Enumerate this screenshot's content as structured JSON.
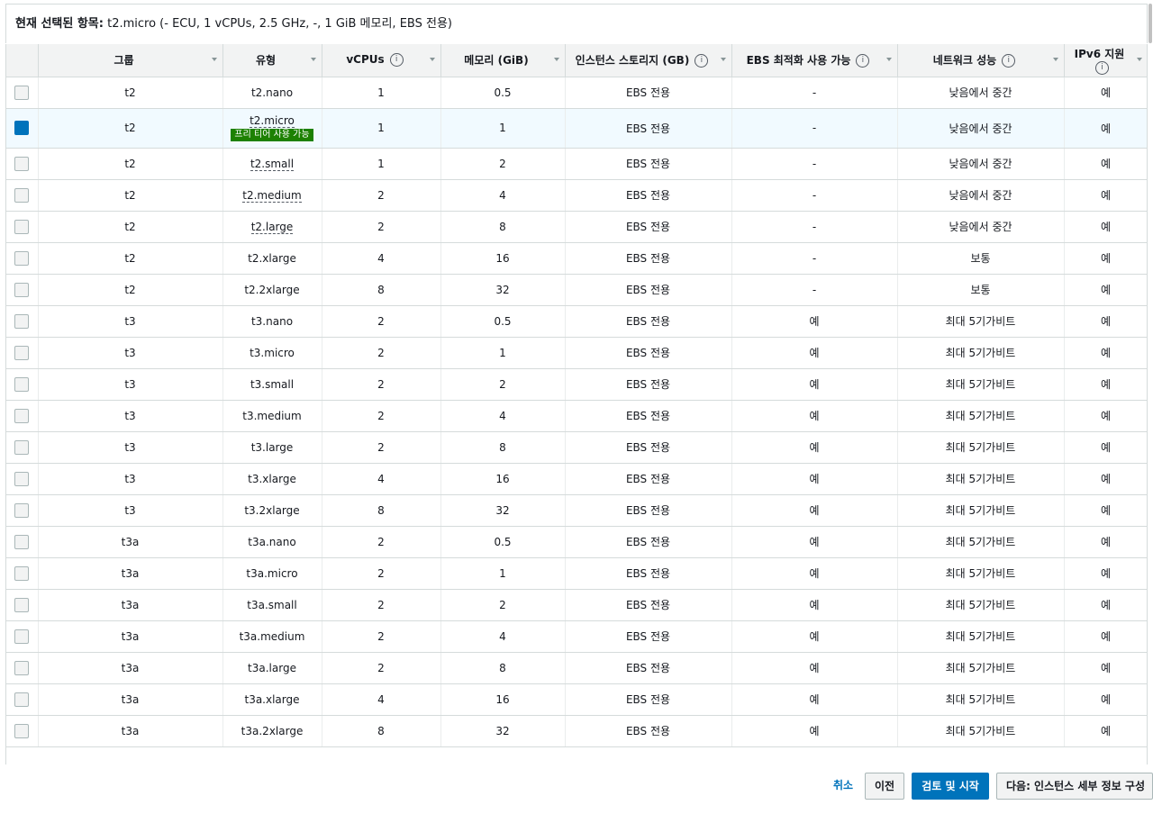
{
  "selection": {
    "label": "현재 선택된 항목:",
    "value": " t2.micro (- ECU, 1 vCPUs, 2.5 GHz, -, 1 GiB 메모리, EBS 전용)"
  },
  "table": {
    "columns": [
      {
        "label": "그룹",
        "info": false
      },
      {
        "label": "유형",
        "info": false
      },
      {
        "label": "vCPUs",
        "info": true
      },
      {
        "label": "메모리 (GiB)",
        "info": false
      },
      {
        "label": "인스턴스 스토리지 (GB)",
        "info": true
      },
      {
        "label": "EBS 최적화 사용 가능",
        "info": true
      },
      {
        "label": "네트워크 성능",
        "info": true
      },
      {
        "label": "IPv6 지원",
        "info": true
      }
    ],
    "info_glyph": "i",
    "free_tier_badge": "프리 티어 사용 가능",
    "rows": [
      {
        "group": "t2",
        "type": "t2.nano",
        "vcpu": "1",
        "memory": "0.5",
        "storage": "EBS 전용",
        "ebs": "-",
        "network": "낮음에서 중간",
        "ipv6": "예",
        "selected": false,
        "free": false,
        "dotted": false
      },
      {
        "group": "t2",
        "type": "t2.micro",
        "vcpu": "1",
        "memory": "1",
        "storage": "EBS 전용",
        "ebs": "-",
        "network": "낮음에서 중간",
        "ipv6": "예",
        "selected": true,
        "free": true,
        "dotted": true
      },
      {
        "group": "t2",
        "type": "t2.small",
        "vcpu": "1",
        "memory": "2",
        "storage": "EBS 전용",
        "ebs": "-",
        "network": "낮음에서 중간",
        "ipv6": "예",
        "selected": false,
        "free": false,
        "dotted": true
      },
      {
        "group": "t2",
        "type": "t2.medium",
        "vcpu": "2",
        "memory": "4",
        "storage": "EBS 전용",
        "ebs": "-",
        "network": "낮음에서 중간",
        "ipv6": "예",
        "selected": false,
        "free": false,
        "dotted": true
      },
      {
        "group": "t2",
        "type": "t2.large",
        "vcpu": "2",
        "memory": "8",
        "storage": "EBS 전용",
        "ebs": "-",
        "network": "낮음에서 중간",
        "ipv6": "예",
        "selected": false,
        "free": false,
        "dotted": true
      },
      {
        "group": "t2",
        "type": "t2.xlarge",
        "vcpu": "4",
        "memory": "16",
        "storage": "EBS 전용",
        "ebs": "-",
        "network": "보통",
        "ipv6": "예",
        "selected": false,
        "free": false,
        "dotted": false
      },
      {
        "group": "t2",
        "type": "t2.2xlarge",
        "vcpu": "8",
        "memory": "32",
        "storage": "EBS 전용",
        "ebs": "-",
        "network": "보통",
        "ipv6": "예",
        "selected": false,
        "free": false,
        "dotted": false
      },
      {
        "group": "t3",
        "type": "t3.nano",
        "vcpu": "2",
        "memory": "0.5",
        "storage": "EBS 전용",
        "ebs": "예",
        "network": "최대 5기가비트",
        "ipv6": "예",
        "selected": false,
        "free": false,
        "dotted": false
      },
      {
        "group": "t3",
        "type": "t3.micro",
        "vcpu": "2",
        "memory": "1",
        "storage": "EBS 전용",
        "ebs": "예",
        "network": "최대 5기가비트",
        "ipv6": "예",
        "selected": false,
        "free": false,
        "dotted": false
      },
      {
        "group": "t3",
        "type": "t3.small",
        "vcpu": "2",
        "memory": "2",
        "storage": "EBS 전용",
        "ebs": "예",
        "network": "최대 5기가비트",
        "ipv6": "예",
        "selected": false,
        "free": false,
        "dotted": false
      },
      {
        "group": "t3",
        "type": "t3.medium",
        "vcpu": "2",
        "memory": "4",
        "storage": "EBS 전용",
        "ebs": "예",
        "network": "최대 5기가비트",
        "ipv6": "예",
        "selected": false,
        "free": false,
        "dotted": false
      },
      {
        "group": "t3",
        "type": "t3.large",
        "vcpu": "2",
        "memory": "8",
        "storage": "EBS 전용",
        "ebs": "예",
        "network": "최대 5기가비트",
        "ipv6": "예",
        "selected": false,
        "free": false,
        "dotted": false
      },
      {
        "group": "t3",
        "type": "t3.xlarge",
        "vcpu": "4",
        "memory": "16",
        "storage": "EBS 전용",
        "ebs": "예",
        "network": "최대 5기가비트",
        "ipv6": "예",
        "selected": false,
        "free": false,
        "dotted": false
      },
      {
        "group": "t3",
        "type": "t3.2xlarge",
        "vcpu": "8",
        "memory": "32",
        "storage": "EBS 전용",
        "ebs": "예",
        "network": "최대 5기가비트",
        "ipv6": "예",
        "selected": false,
        "free": false,
        "dotted": false
      },
      {
        "group": "t3a",
        "type": "t3a.nano",
        "vcpu": "2",
        "memory": "0.5",
        "storage": "EBS 전용",
        "ebs": "예",
        "network": "최대 5기가비트",
        "ipv6": "예",
        "selected": false,
        "free": false,
        "dotted": false
      },
      {
        "group": "t3a",
        "type": "t3a.micro",
        "vcpu": "2",
        "memory": "1",
        "storage": "EBS 전용",
        "ebs": "예",
        "network": "최대 5기가비트",
        "ipv6": "예",
        "selected": false,
        "free": false,
        "dotted": false
      },
      {
        "group": "t3a",
        "type": "t3a.small",
        "vcpu": "2",
        "memory": "2",
        "storage": "EBS 전용",
        "ebs": "예",
        "network": "최대 5기가비트",
        "ipv6": "예",
        "selected": false,
        "free": false,
        "dotted": false
      },
      {
        "group": "t3a",
        "type": "t3a.medium",
        "vcpu": "2",
        "memory": "4",
        "storage": "EBS 전용",
        "ebs": "예",
        "network": "최대 5기가비트",
        "ipv6": "예",
        "selected": false,
        "free": false,
        "dotted": false
      },
      {
        "group": "t3a",
        "type": "t3a.large",
        "vcpu": "2",
        "memory": "8",
        "storage": "EBS 전용",
        "ebs": "예",
        "network": "최대 5기가비트",
        "ipv6": "예",
        "selected": false,
        "free": false,
        "dotted": false
      },
      {
        "group": "t3a",
        "type": "t3a.xlarge",
        "vcpu": "4",
        "memory": "16",
        "storage": "EBS 전용",
        "ebs": "예",
        "network": "최대 5기가비트",
        "ipv6": "예",
        "selected": false,
        "free": false,
        "dotted": false
      },
      {
        "group": "t3a",
        "type": "t3a.2xlarge",
        "vcpu": "8",
        "memory": "32",
        "storage": "EBS 전용",
        "ebs": "예",
        "network": "최대 5기가비트",
        "ipv6": "예",
        "selected": false,
        "free": false,
        "dotted": false
      }
    ]
  },
  "footer": {
    "cancel": "취소",
    "previous": "이전",
    "review_launch": "검토 및 시작",
    "next": "다음: 인스턴스 세부 정보 구성"
  },
  "colors": {
    "primary": "#0073bb",
    "free_tier": "#1d8102",
    "selected_row": "#f1faff"
  }
}
